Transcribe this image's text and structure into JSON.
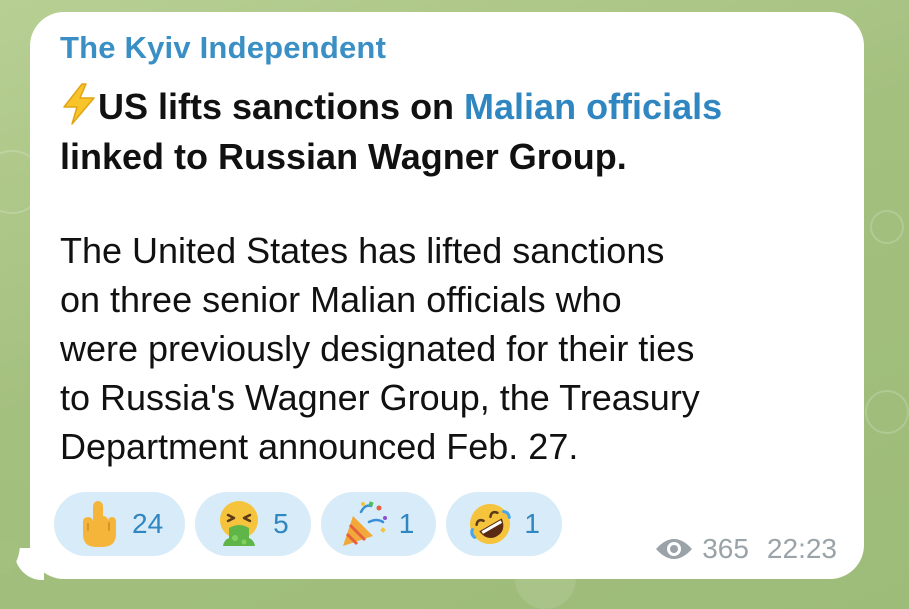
{
  "channel": {
    "name": "The Kyiv Independent"
  },
  "post": {
    "headline_part1": "US lifts sanctions on ",
    "headline_link": "Malian officials",
    "headline_part2": "linked to Russian Wagner Group.",
    "body_lines": [
      "The United States has lifted sanctions",
      "on three senior Malian officials who",
      "were previously designated for their ties",
      "to Russia's Wagner Group, the Treasury",
      "Department announced Feb. 27."
    ]
  },
  "reactions": [
    {
      "icon": "middle-finger-emoji",
      "count": "24"
    },
    {
      "icon": "vomiting-face-emoji",
      "count": "5"
    },
    {
      "icon": "party-popper-emoji",
      "count": "1"
    },
    {
      "icon": "rolling-laughing-emoji",
      "count": "1"
    }
  ],
  "meta": {
    "views": "365",
    "time": "22:23"
  },
  "colors": {
    "link": "#2f86c0",
    "reaction_bg": "#d7ebf8",
    "channel_name": "#3a8fc4"
  }
}
